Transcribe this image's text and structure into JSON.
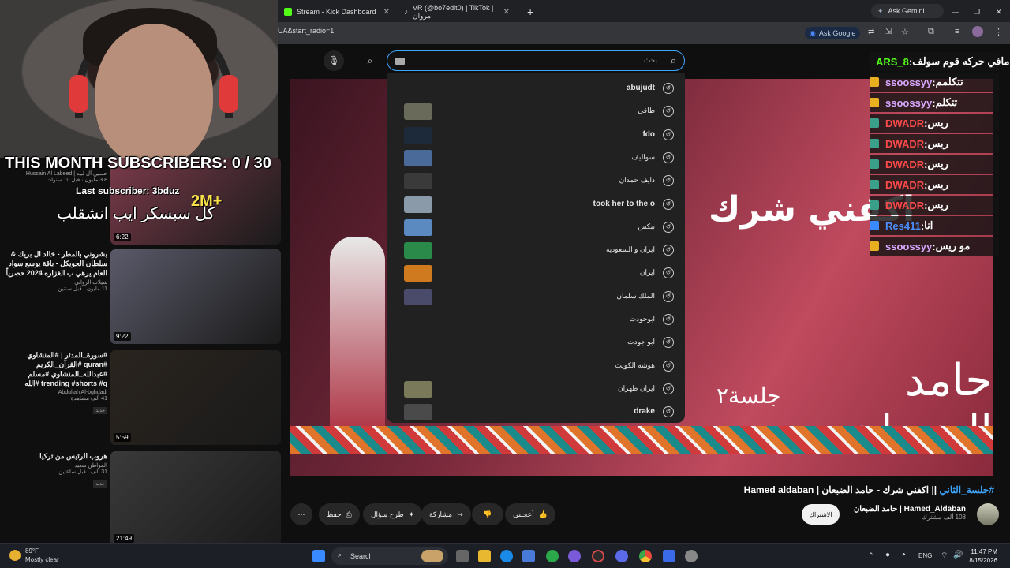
{
  "browser": {
    "tabs": [
      {
        "label": "Stream - Kick Dashboard",
        "color": "#53fc18"
      },
      {
        "label": "VR (@bo7edit0) | TikTok | مروان",
        "color": "#111"
      }
    ],
    "url": "UA&start_radio=1",
    "ask_gemini": "Ask Gemini",
    "ask_google": "Ask Google"
  },
  "search": {
    "placeholder": "بحث",
    "suggestions": [
      {
        "text": "abujudt",
        "bold": true,
        "thumb": false
      },
      {
        "text": "طاقي",
        "bold": false,
        "thumb": true,
        "thumb_color": "#6a6a5a"
      },
      {
        "text": "fdo",
        "bold": true,
        "thumb": true,
        "thumb_color": "#1d2a3a"
      },
      {
        "text": "سواليف",
        "bold": false,
        "thumb": true,
        "thumb_color": "#4a6a9a"
      },
      {
        "text": "دايف حمدان",
        "bold": false,
        "thumb": true,
        "thumb_color": "#3a3a3a"
      },
      {
        "text": "took her to the o",
        "bold": true,
        "thumb": true,
        "thumb_color": "#8a9aa8"
      },
      {
        "text": "بيكس",
        "bold": false,
        "thumb": true,
        "thumb_color": "#5a8ac0"
      },
      {
        "text": "ايران و السعوديه",
        "bold": false,
        "thumb": true,
        "thumb_color": "#2a8a4a"
      },
      {
        "text": "ايران",
        "bold": false,
        "thumb": true,
        "thumb_color": "#d07a20"
      },
      {
        "text": "الملك سلمان",
        "bold": false,
        "thumb": true,
        "thumb_color": "#4a4a6a"
      },
      {
        "text": "ابوجودت",
        "bold": false,
        "thumb": false
      },
      {
        "text": "ابو جودت",
        "bold": false,
        "thumb": false
      },
      {
        "text": "هوشه الكويت",
        "bold": false,
        "thumb": false
      },
      {
        "text": "ايران طهران",
        "bold": false,
        "thumb": true,
        "thumb_color": "#7a7a5a"
      },
      {
        "text": "drake",
        "bold": true,
        "thumb": true,
        "thumb_color": "#4a4a4a"
      }
    ]
  },
  "video": {
    "title_tag": "#جلسة_الثاني",
    "title_rest": " || اكفني شرك - حامد الضبعان | Hamed aldaban",
    "art_line1": "اكفني شرك",
    "art_line2": "حامد الضبعان",
    "art_line3": "جلسة٢",
    "channel": "Hamed_Aldaban | حامد الضبعان",
    "subs": "108 ألف مشترك",
    "subscribe": "الاشتراك",
    "actions": {
      "like": "أعجبني",
      "share": "مشاركة",
      "ask": "طرح سؤال",
      "save": "حفظ"
    }
  },
  "sidebar": {
    "videos": [
      {
        "title": "",
        "channel": "حسين آل لبيد | Hussain Al Labeed",
        "views": "3.8 مليون · قبل 10 سنوات",
        "duration": "6:22",
        "color": "#7a3a4a"
      },
      {
        "title": "بشروني بالمطر - خالد ال بريك & سلطان الجويكل - باقة يوسع سواد العام يرهي ب الغزاره 2024 حصرياً",
        "channel": "شيلات الرواني",
        "views": "11 مليون · قبل سنتين",
        "duration": "9:22",
        "color": "#5a5a6a"
      },
      {
        "title": "#سورة_المدثر | #المنشاوي #quran #القرآن_الكريم #عبدالله_المنشاوي #مسلم trending #shorts #q #الله",
        "channel": "Abdullah Al-bghdadi",
        "views": "41 ألف مشاهدة",
        "badge": "جديد",
        "duration": "5:59",
        "color": "#2a241e"
      },
      {
        "title": "هروب الرئيس من تركيا",
        "channel": "المواطن سعيد",
        "views": "31 ألف · قبل ساعتين",
        "badge": "جديد",
        "duration": "21:49",
        "color": "#3a3a3a"
      }
    ]
  },
  "overlay": {
    "goal": "THIS MONTH SUBSCRIBERS: 0 / 30",
    "last_sub": "Last subscriber: 3bduz",
    "arabic": "كل سبسكر ايب انشقلب",
    "badge": "2M+"
  },
  "chat": [
    {
      "user": "ARS_8",
      "msg": "مافي حركه قوم سولف",
      "color": "#53fc18",
      "badge": "#111"
    },
    {
      "user": "ssoossyy",
      "msg": "تتكلمم",
      "color": "#d8a8ff",
      "badge": "#e8b020"
    },
    {
      "user": "ssoossyy",
      "msg": "تتكلم",
      "color": "#d8a8ff",
      "badge": "#e8b020"
    },
    {
      "user": "DWADR",
      "msg": "ريس",
      "color": "#ff4a4a",
      "badge": "#3aa08a"
    },
    {
      "user": "DWADR",
      "msg": "ريس",
      "color": "#ff4a4a",
      "badge": "#3aa08a"
    },
    {
      "user": "DWADR",
      "msg": "ريس",
      "color": "#ff4a4a",
      "badge": "#3aa08a"
    },
    {
      "user": "DWADR",
      "msg": "ريس",
      "color": "#ff4a4a",
      "badge": "#3aa08a"
    },
    {
      "user": "DWADR",
      "msg": "ريس",
      "color": "#ff4a4a",
      "badge": "#3aa08a"
    },
    {
      "user": "Res411",
      "msg": "انا",
      "color": "#4a90ff",
      "badge": "#3a8aff"
    },
    {
      "user": "ssoossyy",
      "msg": "مو ريس",
      "color": "#d8a8ff",
      "badge": "#e8b020"
    }
  ],
  "taskbar": {
    "temp": "89°F",
    "weather": "Mostly clear",
    "search": "Search",
    "lang": "ENG",
    "time": "11:47 PM",
    "date": "8/15/2026"
  }
}
